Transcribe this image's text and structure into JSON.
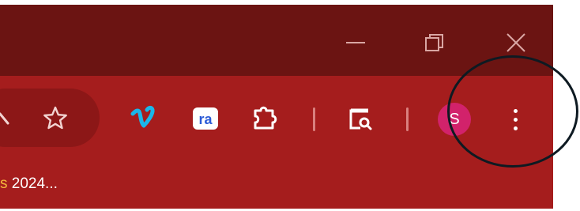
{
  "window_controls": {
    "minimize_icon": "minimize-icon",
    "maximize_icon": "restore-icon",
    "close_icon": "close-icon"
  },
  "toolbar": {
    "omnibox_icons": [
      "search-icon",
      "bookmark-star-icon"
    ],
    "extensions": [
      {
        "name": "vimeo-icon",
        "glyph": "v",
        "color": "#1ab7ea"
      },
      {
        "name": "ra-extension-icon",
        "glyph": "ra",
        "color": "#2b5bd7"
      },
      {
        "name": "extensions-puzzle-icon"
      }
    ],
    "tab_search_icon": "tab-search-icon",
    "profile_initial": "S",
    "profile_color": "#d2226b",
    "menu_icon": "three-dot-menu-icon"
  },
  "bookmarks_bar": {
    "item_prefix": "s",
    "item_text": " 2024..."
  },
  "annotation": {
    "shape": "circle",
    "color": "#0e1a22"
  },
  "colors": {
    "titlebar": "#6b1412",
    "toolbar": "#a51d1d"
  }
}
